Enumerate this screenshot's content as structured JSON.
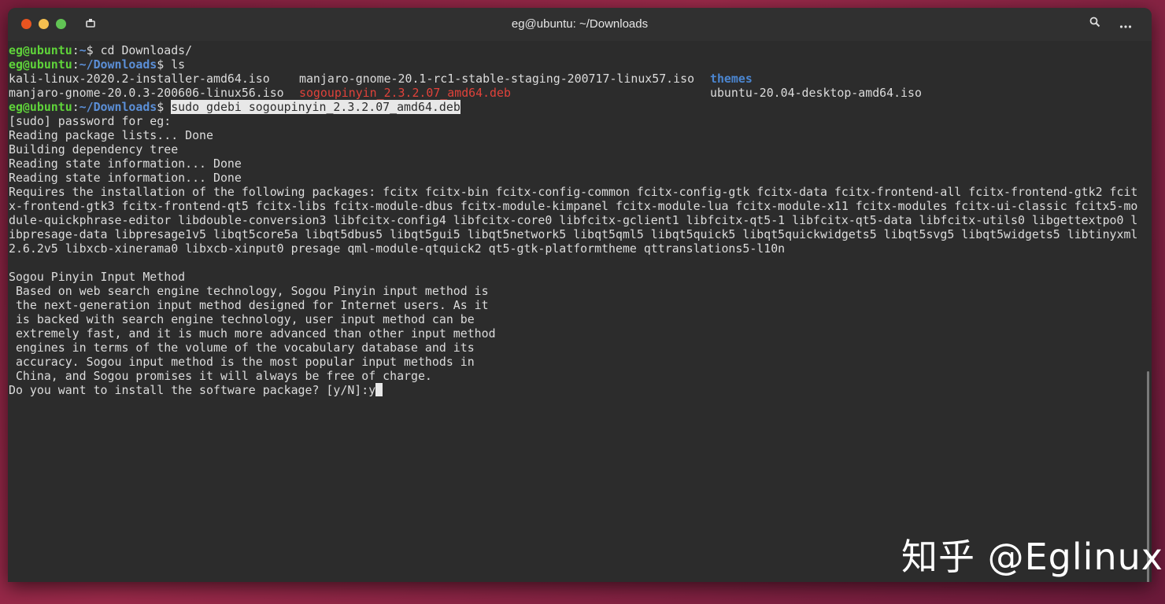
{
  "window": {
    "title": "eg@ubuntu: ~/Downloads"
  },
  "prompt": {
    "user": "eg@ubuntu",
    "home_path": "~",
    "dl_path": "~/Downloads"
  },
  "commands": {
    "cd": "cd Downloads/",
    "ls": "ls",
    "install": "sudo gdebi sogoupinyin_2.3.2.07_amd64.deb"
  },
  "ls_output": {
    "row1": [
      "kali-linux-2020.2-installer-amd64.iso",
      "manjaro-gnome-20.1-rc1-stable-staging-200717-linux57.iso",
      "themes"
    ],
    "row2": [
      "manjaro-gnome-20.0.3-200606-linux56.iso",
      "sogoupinyin_2.3.2.07_amd64.deb",
      "ubuntu-20.04-desktop-amd64.iso"
    ]
  },
  "output_lines": [
    "[sudo] password for eg:",
    "Reading package lists... Done",
    "Building dependency tree",
    "Reading state information... Done",
    "Reading state information... Done"
  ],
  "requires_lines": [
    "Requires the installation of the following packages: fcitx fcitx-bin fcitx-config-common fcitx-config-gtk fcitx-data fcitx-frontend-all fcitx-frontend-gtk2 fcit",
    "x-frontend-gtk3 fcitx-frontend-qt5 fcitx-libs fcitx-module-dbus fcitx-module-kimpanel fcitx-module-lua fcitx-module-x11 fcitx-modules fcitx-ui-classic fcitx5-mo",
    "dule-quickphrase-editor libdouble-conversion3 libfcitx-config4 libfcitx-core0 libfcitx-gclient1 libfcitx-qt5-1 libfcitx-qt5-data libfcitx-utils0 libgettextpo0 l",
    "ibpresage-data libpresage1v5 libqt5core5a libqt5dbus5 libqt5gui5 libqt5network5 libqt5qml5 libqt5quick5 libqt5quickwidgets5 libqt5svg5 libqt5widgets5 libtinyxml",
    "2.6.2v5 libxcb-xinerama0 libxcb-xinput0 presage qml-module-qtquick2 qt5-gtk-platformtheme qttranslations5-l10n"
  ],
  "description_lines": [
    "Sogou Pinyin Input Method",
    " Based on web search engine technology, Sogou Pinyin input method is",
    " the next-generation input method designed for Internet users. As it",
    " is backed with search engine technology, user input method can be",
    " extremely fast, and it is much more advanced than other input method",
    " engines in terms of the volume of the vocabulary database and its",
    " accuracy. Sogou input method is the most popular input methods in",
    " China, and Sogou promises it will always be free of charge."
  ],
  "question": "Do you want to install the software package? [y/N]:",
  "answer": "y",
  "watermark": "知乎 @Eglinux",
  "colors": {
    "user": "#5fd33a",
    "path": "#5b8fd7",
    "deb": "#e0423a",
    "dir": "#4b86d1",
    "bg": "#2c2c2c"
  }
}
